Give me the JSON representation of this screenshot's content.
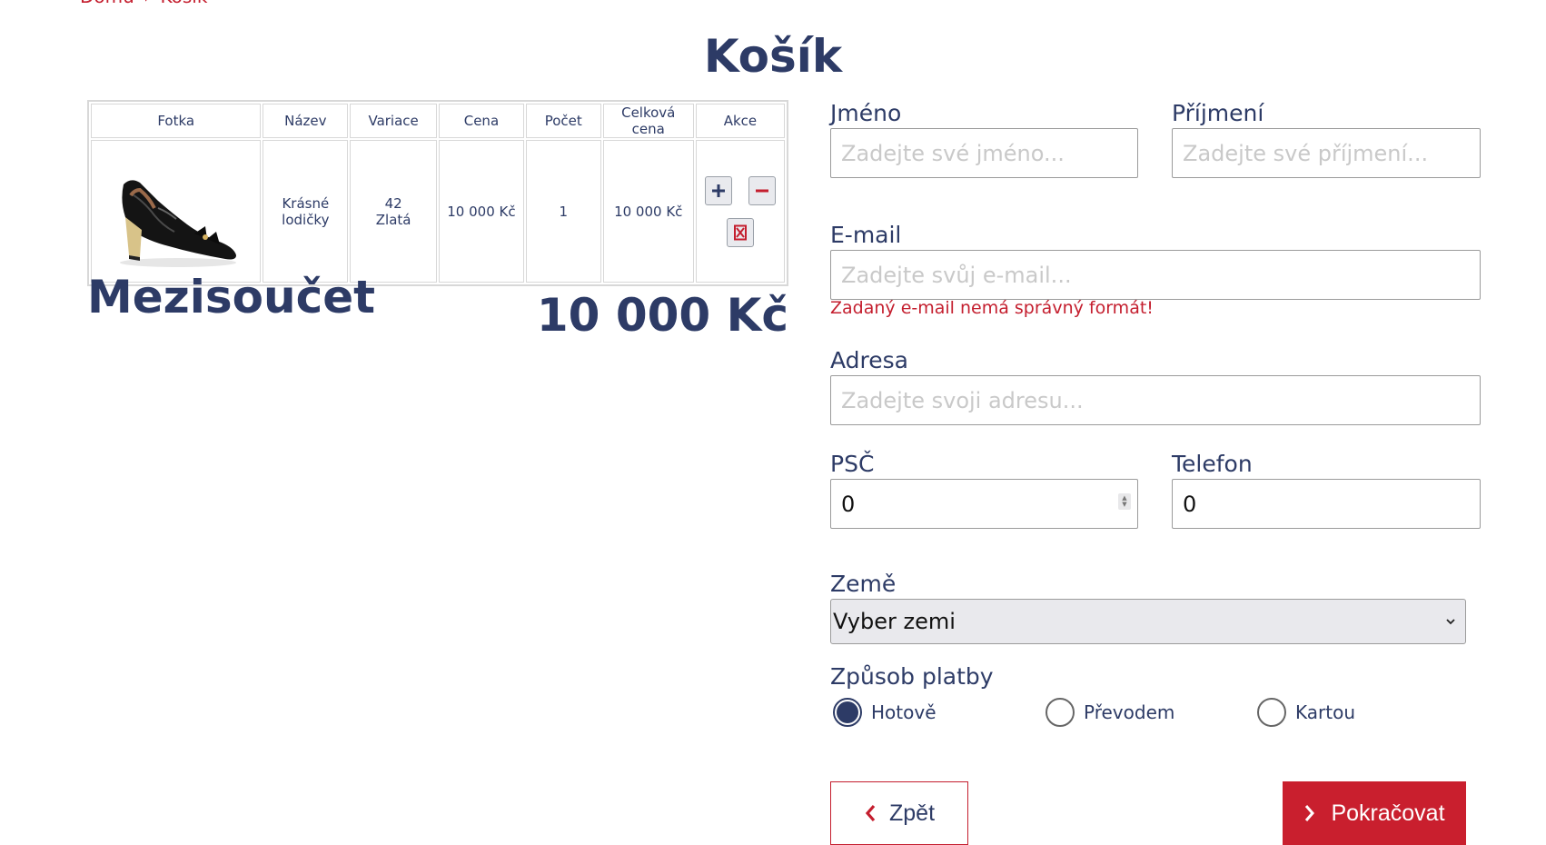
{
  "breadcrumb": {
    "home": "Domů",
    "separator": "›",
    "current": "Košík"
  },
  "page_title": "Košík",
  "cart": {
    "headers": [
      "Fotka",
      "Název",
      "Variace",
      "Cena",
      "Počet",
      "Celková cena",
      "Akce"
    ],
    "rows": [
      {
        "name_line1": "Krásné",
        "name_line2": "lodičky",
        "variant_size": "42",
        "variant_color": "Zlatá",
        "price": "10 000 Kč",
        "quantity": "1",
        "total": "10 000 Kč"
      }
    ]
  },
  "subtotal": {
    "label": "Mezisoučet",
    "value": "10 000 Kč"
  },
  "form": {
    "first_name": {
      "label": "Jméno",
      "placeholder": "Zadejte své jméno..."
    },
    "last_name": {
      "label": "Příjmení",
      "placeholder": "Zadejte své příjmení..."
    },
    "email": {
      "label": "E-mail",
      "placeholder": "Zadejte svůj e-mail...",
      "error": "Zadaný e-mail nemá správný formát!"
    },
    "address": {
      "label": "Adresa",
      "placeholder": "Zadejte svoji adresu..."
    },
    "zip": {
      "label": "PSČ",
      "value": "0"
    },
    "phone": {
      "label": "Telefon",
      "value": "0"
    },
    "country": {
      "label": "Země",
      "selected": "Vyber zemi"
    },
    "payment": {
      "label": "Způsob platby",
      "options": [
        "Hotově",
        "Převodem",
        "Kartou"
      ],
      "selected": "Hotově"
    }
  },
  "buttons": {
    "back": "Zpět",
    "continue": "Pokračovat"
  },
  "colors": {
    "primary": "#2d3b66",
    "accent": "#c91f2e",
    "error": "#c41e2e"
  },
  "icons": {
    "increase": "plus-icon",
    "decrease": "minus-icon",
    "remove": "delete-icon",
    "back": "chevron-left-icon",
    "continue": "chevron-right-icon",
    "select": "chevron-down-icon"
  }
}
